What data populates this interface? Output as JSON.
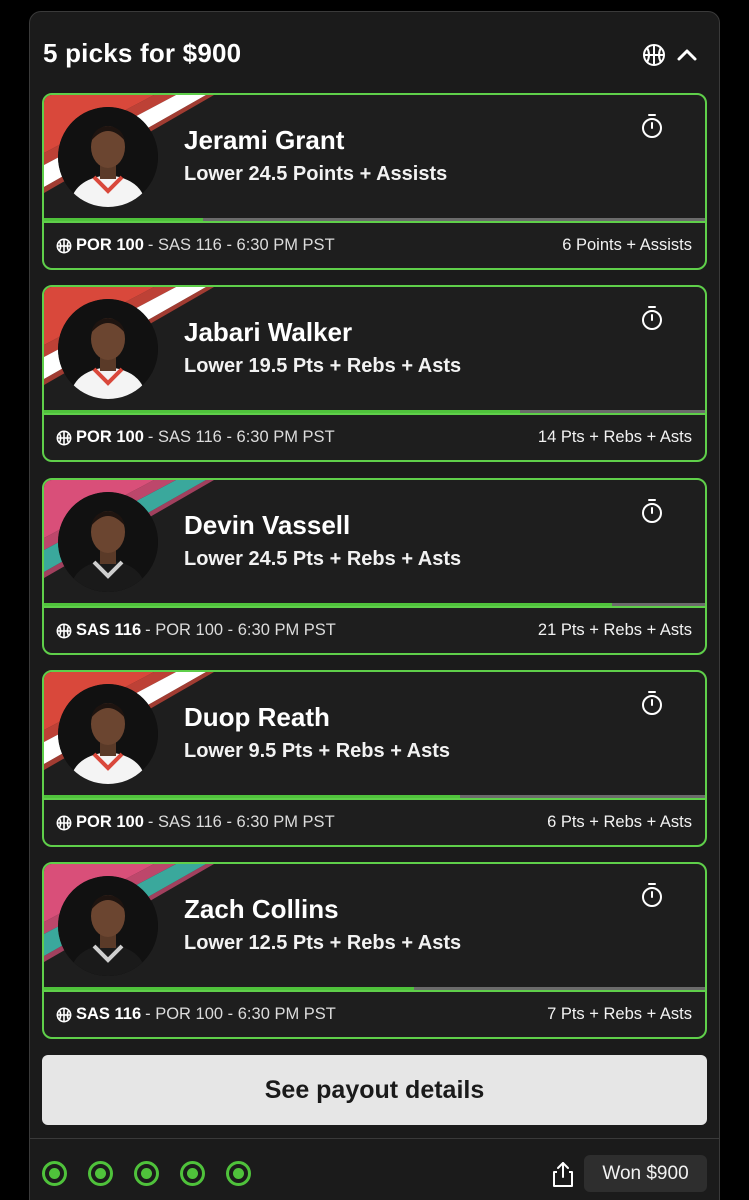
{
  "header": {
    "title": "5 picks for $900",
    "sport_icon": "basketball-icon",
    "collapse_icon": "chevron-up-icon"
  },
  "colors": {
    "accent_green": "#4fc23b",
    "border_green": "#5fcf4a",
    "por_red": "#d9483b",
    "sas_pink": "#d94f79",
    "sas_teal": "#3aa89c",
    "stripe_white": "#ffffff"
  },
  "picks": [
    {
      "player": "Jerami Grant",
      "pick": "Lower 24.5 Points + Assists",
      "team": "POR 100",
      "rest": "- SAS 116 - 6:30 PM PST",
      "result": "6 Points + Assists",
      "progress_pct": 24,
      "stripe": "por"
    },
    {
      "player": "Jabari Walker",
      "pick": "Lower 19.5 Pts + Rebs + Asts",
      "team": "POR 100",
      "rest": "- SAS 116 - 6:30 PM PST",
      "result": "14 Pts + Rebs + Asts",
      "progress_pct": 72,
      "stripe": "por"
    },
    {
      "player": "Devin Vassell",
      "pick": "Lower 24.5 Pts + Rebs + Asts",
      "team": "SAS 116",
      "rest": "- POR 100 - 6:30 PM PST",
      "result": "21 Pts + Rebs + Asts",
      "progress_pct": 86,
      "stripe": "sas"
    },
    {
      "player": "Duop Reath",
      "pick": "Lower 9.5 Pts + Rebs + Asts",
      "team": "POR 100",
      "rest": "- SAS 116 - 6:30 PM PST",
      "result": "6 Pts + Rebs + Asts",
      "progress_pct": 63,
      "stripe": "por"
    },
    {
      "player": "Zach Collins",
      "pick": "Lower 12.5 Pts + Rebs + Asts",
      "team": "SAS 116",
      "rest": "- POR 100 - 6:30 PM PST",
      "result": "7 Pts + Rebs + Asts",
      "progress_pct": 56,
      "stripe": "sas"
    }
  ],
  "payout_button": "See payout details",
  "footer": {
    "status": "Won $900",
    "share_icon": "share-icon",
    "completed_picks": 5
  }
}
